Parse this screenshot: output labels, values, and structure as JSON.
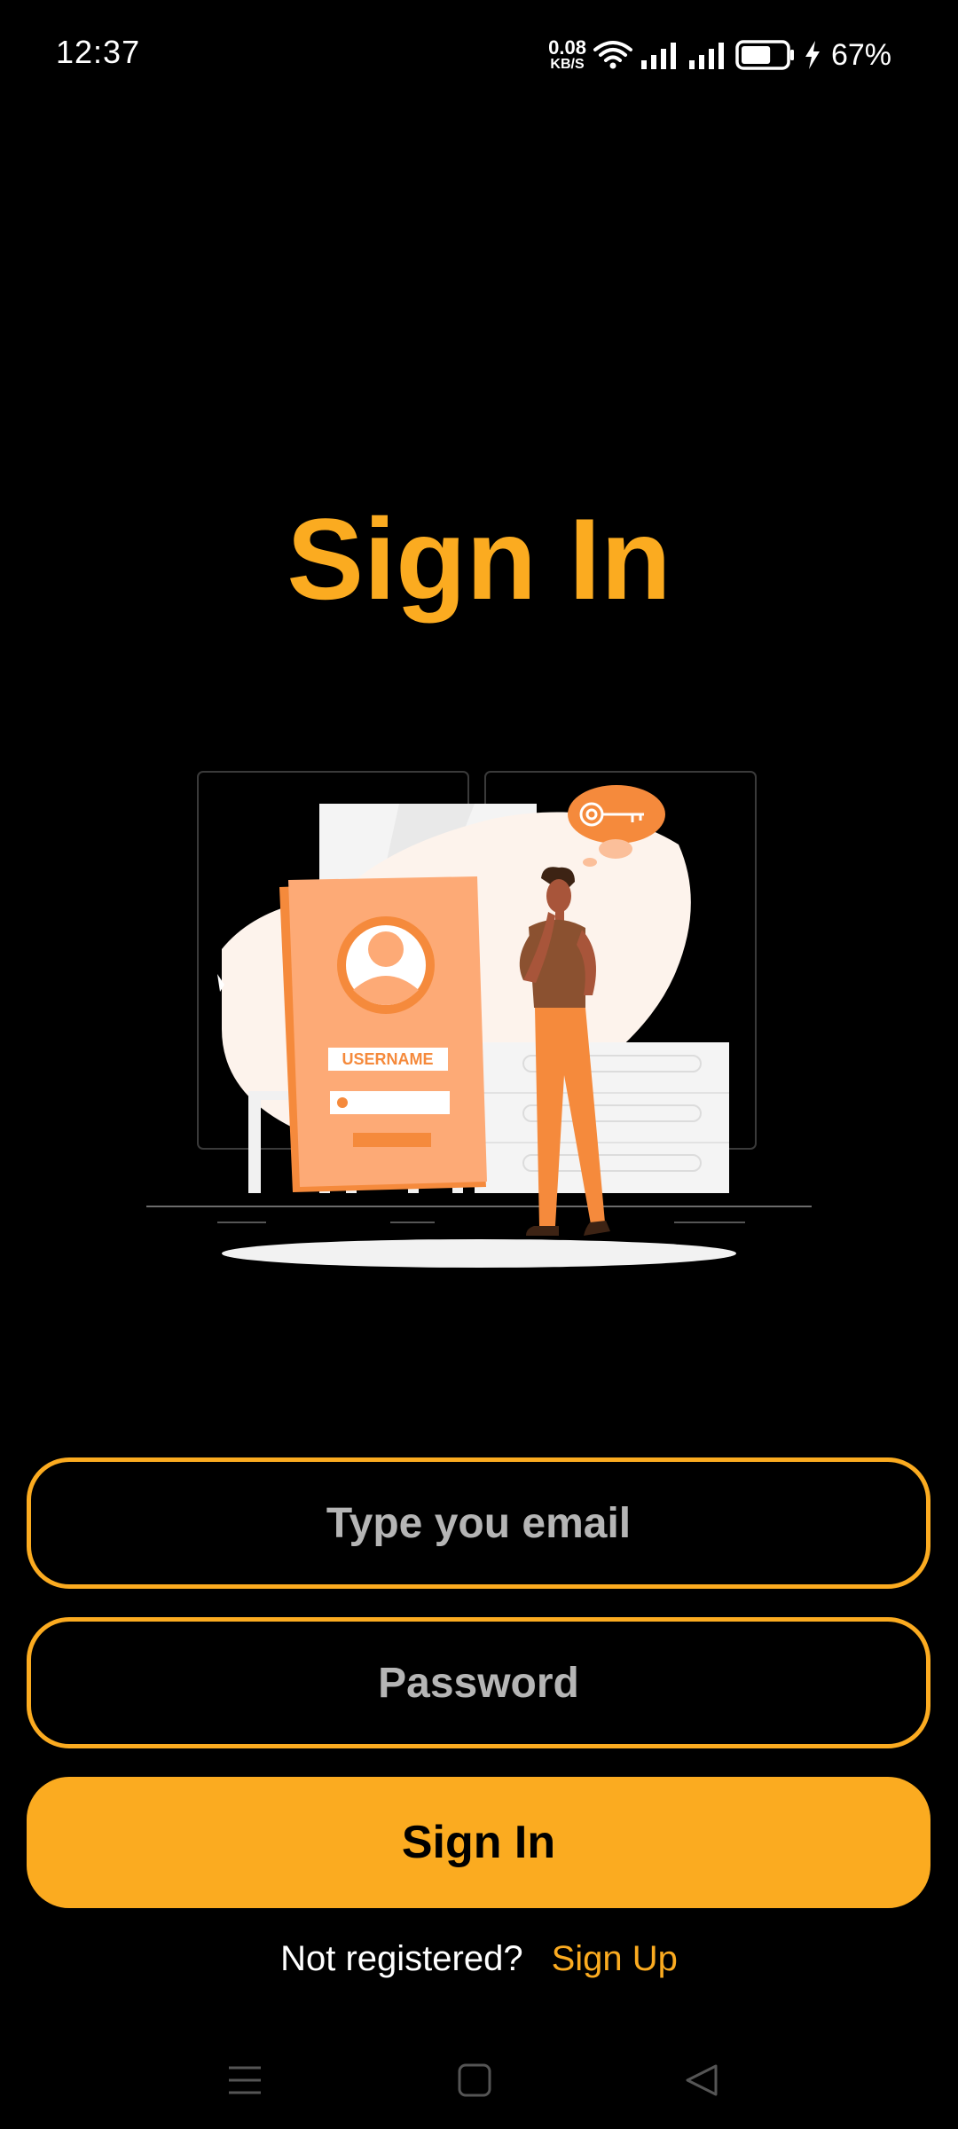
{
  "status_bar": {
    "time": "12:37",
    "net_speed_value": "0.08",
    "net_speed_unit": "KB/S",
    "battery_percent": "67%",
    "battery_level": 0.67,
    "icons": [
      "wifi-icon",
      "signal-icon",
      "signal-icon",
      "battery-icon",
      "charging-icon"
    ]
  },
  "title": "Sign In",
  "illustration": {
    "username_label": "USERNAME",
    "icons": [
      "user-avatar-icon",
      "key-icon"
    ]
  },
  "form": {
    "email_placeholder": "Type you email",
    "email_value": "",
    "password_placeholder": "Password",
    "password_value": "",
    "submit_label": "Sign In"
  },
  "footer": {
    "register_prompt": "Not registered?",
    "signup_label": "Sign Up"
  },
  "nav_bar": {
    "icons": [
      "menu-icon",
      "home-icon",
      "back-icon"
    ]
  },
  "colors": {
    "accent": "#fbab20",
    "background": "#000000",
    "illustration_orange": "#f58a3c",
    "illustration_peach": "#fdaa76"
  }
}
